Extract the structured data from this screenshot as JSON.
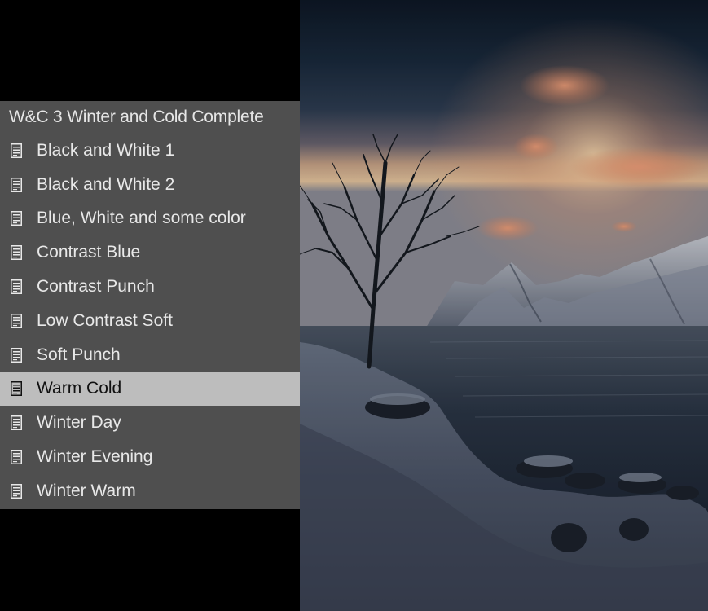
{
  "preset_panel": {
    "group_title": "W&C 3 Winter and Cold Complete",
    "item_icon": "preset-icon",
    "selected_index": 7,
    "items": [
      {
        "label": "Black and White 1"
      },
      {
        "label": "Black and White 2"
      },
      {
        "label": "Blue, White and some color"
      },
      {
        "label": "Contrast Blue"
      },
      {
        "label": "Contrast Punch"
      },
      {
        "label": "Low Contrast Soft"
      },
      {
        "label": "Soft Punch"
      },
      {
        "label": "Warm Cold"
      },
      {
        "label": "Winter Day"
      },
      {
        "label": "Winter Evening"
      },
      {
        "label": "Winter Warm"
      }
    ]
  },
  "colors": {
    "panel_bg": "#4f4f4f",
    "selected_bg": "#bdbdbd",
    "page_bg": "#000000"
  }
}
